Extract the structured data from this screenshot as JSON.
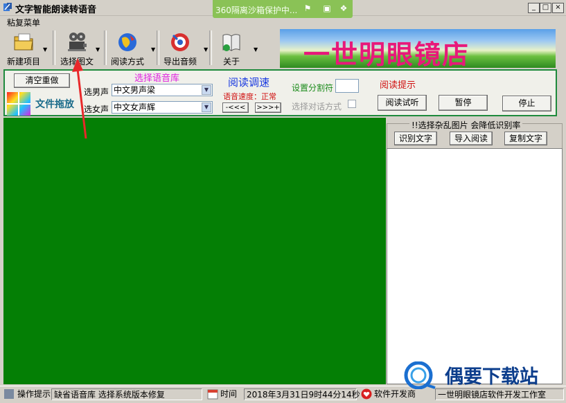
{
  "window": {
    "title": "文字智能朗读转语音",
    "min_glyph": "_",
    "max_glyph": "□",
    "close_glyph": "×"
  },
  "sandbox": {
    "text": "360隔离沙箱保护中..."
  },
  "menu": {
    "label": "粘复菜单"
  },
  "toolbar": {
    "new_project": "新建项目",
    "select_image_text": "选择图文",
    "read_mode": "阅读方式",
    "export_audio": "导出音频",
    "about": "关于"
  },
  "banner": {
    "text": "一世明眼镜店"
  },
  "panel": {
    "clear_button": "清空重做",
    "file_drop": "文件拖放",
    "voice_library_title": "选择语音库",
    "male_voice_label": "选男声",
    "male_voice_value": "中文男声梁",
    "female_voice_label": "选女声",
    "female_voice_value": "中文女声辉",
    "speed_title": "阅读调速",
    "speed_status": "语音速度：正常",
    "slower_button": "-<<<",
    "faster_button": ">>>+",
    "separator_label": "设置分割符",
    "separator_value": "",
    "dialog_mode_label": "选择对话方式",
    "tips_title": "阅读提示",
    "listen_button": "阅读试听",
    "pause_button": "暂停",
    "stop_button": "停止",
    "accent_colors": {
      "voice_title": "#e020e0",
      "speed_title": "#1a3ae0",
      "speed_status": "#d01010",
      "separator": "#1a8a1a",
      "tips": "#d01010",
      "file_drop": "#1a6b8a"
    }
  },
  "ocr": {
    "note": "!!选择杂乱图片   会降低识别率",
    "recognize_button": "识别文字",
    "import_button": "导入阅读",
    "copy_button": "复制文字"
  },
  "status": {
    "tips_label": "操作提示",
    "tips_value": "缺省语音库  选择系统版本修复",
    "time_label": "时间",
    "time_value": "2018年3月31日9时44分14秒",
    "dev_label": "软件开发商",
    "dev_value": "一世明眼镜店软件开发工作室"
  },
  "watermark": {
    "text": "偶要下载站"
  },
  "colors": {
    "editor_bg": "#047f05",
    "panel_border": "#1e8a3c",
    "arrow": "#e8282a"
  },
  "icons": {
    "app": "app-icon",
    "new_project": "folder-icon",
    "select_image_text": "film-projector-icon",
    "read_mode": "globe-icon",
    "export_audio": "music-disc-icon",
    "about": "book-icon",
    "file_drop": "color-grid-icon",
    "dev": "heart-icon",
    "time": "calendar-icon"
  }
}
